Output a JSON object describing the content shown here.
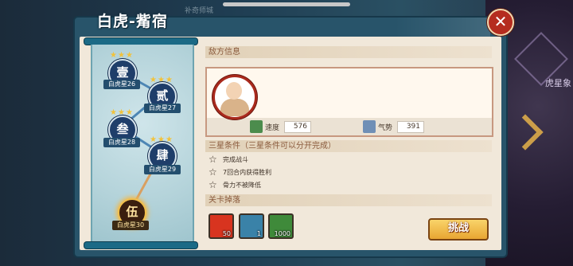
{
  "dialog": {
    "title": "白虎-觜宿",
    "close_label": "✕",
    "ghost_tab": "补奇师城"
  },
  "background": {
    "right_label": "虎星象"
  },
  "stage_map": {
    "nodes": [
      {
        "glyph": "壹",
        "label": "白虎星26",
        "stars": "★★★",
        "current": false
      },
      {
        "glyph": "贰",
        "label": "白虎星27",
        "stars": "★★★",
        "current": false
      },
      {
        "glyph": "叁",
        "label": "白虎星28",
        "stars": "★★★",
        "current": false
      },
      {
        "glyph": "肆",
        "label": "白虎星29",
        "stars": "★★★",
        "current": false
      },
      {
        "glyph": "伍",
        "label": "白虎星30",
        "stars": "",
        "current": true
      }
    ]
  },
  "enemy_info": {
    "heading": "敌方信息",
    "stats": [
      {
        "name": "速度",
        "value": "576",
        "icon": "speed-icon"
      },
      {
        "name": "气势",
        "value": "391",
        "icon": "momentum-icon"
      }
    ]
  },
  "three_star": {
    "heading": "三星条件（三星条件可以分开完成）",
    "conditions": [
      "完成战斗",
      "7回合内获得胜利",
      "骨力不被降低"
    ]
  },
  "drops": {
    "heading": "关卡掉落",
    "items": [
      {
        "icon": "gold-ingot-icon",
        "qty": "50",
        "color": "#d8341f"
      },
      {
        "icon": "blue-orb-icon",
        "qty": "1",
        "color": "#3a82a8"
      },
      {
        "icon": "green-coin-icon",
        "qty": "1000",
        "color": "#3f8a3a"
      }
    ]
  },
  "actions": {
    "challenge_label": "挑战"
  }
}
